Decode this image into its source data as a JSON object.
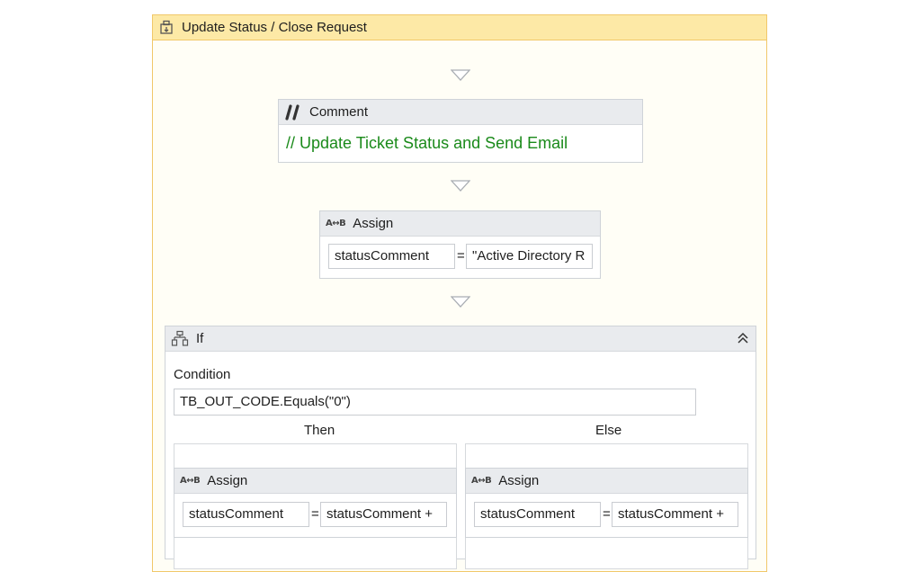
{
  "sequence": {
    "title": "Update Status / Close Request"
  },
  "comment": {
    "header": "Comment",
    "text": "// Update Ticket Status and Send Email"
  },
  "assign_main": {
    "header": "Assign",
    "to": "statusComment",
    "equals": "=",
    "value": "\"Active Directory R"
  },
  "if_block": {
    "header": "If",
    "condition_label": "Condition",
    "condition_value": "TB_OUT_CODE.Equals(\"0\")",
    "then_label": "Then",
    "else_label": "Else",
    "then_assign": {
      "header": "Assign",
      "to": "statusComment",
      "equals": "=",
      "value": "statusComment +"
    },
    "else_assign": {
      "header": "Assign",
      "to": "statusComment",
      "equals": "=",
      "value": "statusComment +"
    }
  },
  "icons": {
    "sequence": "sequence-icon",
    "comment": "comment-slashes-icon",
    "assign": "assign-ab-icon",
    "if": "if-icon",
    "collapse": "collapse-chevron-icon",
    "drop_arrow": "drop-arrow-icon"
  },
  "colors": {
    "sequence_header": "#fde9a6",
    "sequence_border": "#f1c86a",
    "comment_text": "#1a8a1a",
    "activity_header": "#e9ebee"
  }
}
